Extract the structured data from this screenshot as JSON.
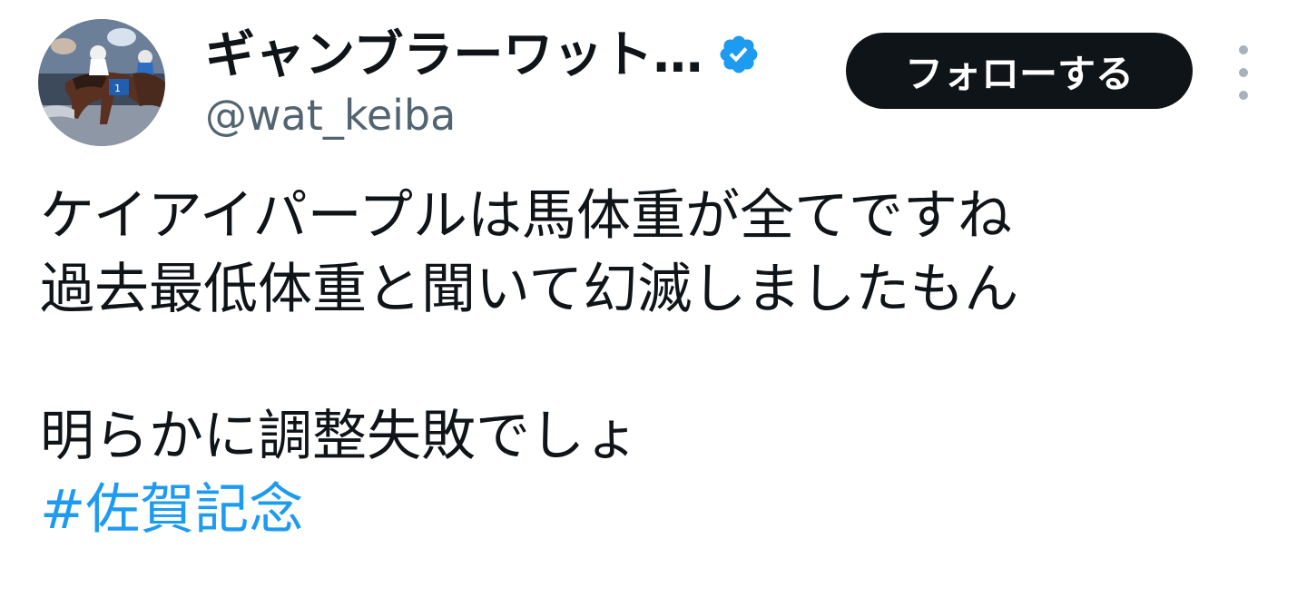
{
  "author": {
    "display_name": "ギャンブラーワット…",
    "handle": "@wat_keiba",
    "verified": true,
    "avatar_icon": "avatar-horse-racing-photo"
  },
  "actions": {
    "follow_label": "フォローする",
    "more_icon": "more-vertical-icon"
  },
  "tweet": {
    "lines": [
      "ケイアイパープルは馬体重が全てですね",
      "過去最低体重と聞いて幻滅しましたもん",
      "",
      "明らかに調整失敗でしょ"
    ],
    "hashtag": "#佐賀記念"
  },
  "colors": {
    "text": "#0f1419",
    "secondary_text": "#536471",
    "link": "#1d9bf0",
    "verified_badge": "#1d9bf0",
    "follow_button_bg": "#0f1419",
    "follow_button_text": "#ffffff"
  }
}
